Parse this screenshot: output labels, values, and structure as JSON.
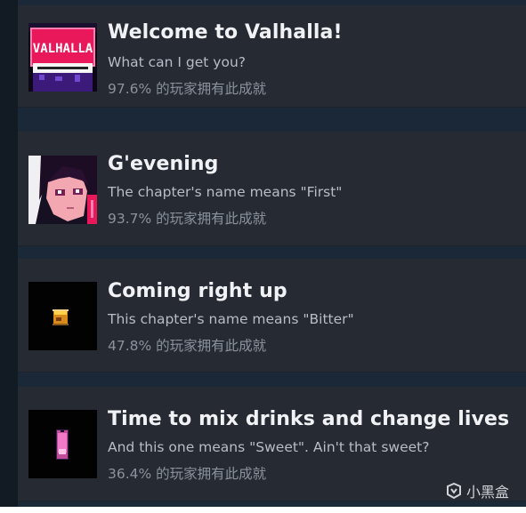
{
  "achievements": [
    {
      "title": "Welcome to Valhalla!",
      "description": "What can I get you?",
      "unlock_rate": "97.6% 的玩家拥有此成就",
      "icon": "valhalla-sign-icon",
      "icon_text": "VALHALLA"
    },
    {
      "title": "G'evening",
      "description": "The chapter's name means \"First\"",
      "unlock_rate": "93.7% 的玩家拥有此成就",
      "icon": "character-portrait-icon"
    },
    {
      "title": "Coming right up",
      "description": "This chapter's name means \"Bitter\"",
      "unlock_rate": "47.8% 的玩家拥有此成就",
      "icon": "drink-glass-icon"
    },
    {
      "title": "Time to mix drinks and change lives",
      "description": "And this one means \"Sweet\". Ain't that sweet?",
      "unlock_rate": "36.4% 的玩家拥有此成就",
      "icon": "phone-icon"
    }
  ],
  "watermark": {
    "label": "小黑盒",
    "icon": "heybox-logo-icon"
  },
  "colors": {
    "background": "#1b2838",
    "card": "#262a33",
    "title": "#f0f2f5",
    "description": "#b7bdc6",
    "unlock_rate": "#8b929b"
  }
}
